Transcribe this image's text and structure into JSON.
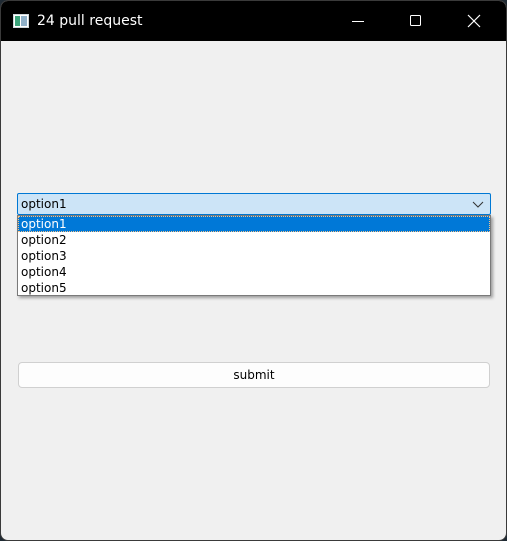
{
  "window": {
    "title": "24 pull request",
    "controls": {
      "minimize": "minimize-icon",
      "maximize": "maximize-icon",
      "close": "close-icon"
    }
  },
  "form": {
    "combo": {
      "selected_value": "option1",
      "options": [
        "option1",
        "option2",
        "option3",
        "option4",
        "option5"
      ],
      "highlighted_index": 0
    },
    "submit_label": "submit"
  },
  "colors": {
    "titlebar": "#000000",
    "window_bg": "#f0f0f0",
    "combo_bg": "#cce4f7",
    "accent": "#0078d7"
  }
}
